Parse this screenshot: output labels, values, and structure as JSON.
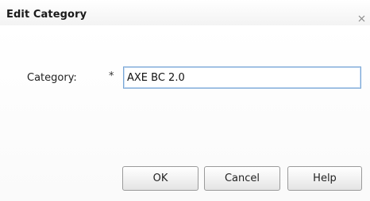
{
  "dialog": {
    "title": "Edit Category"
  },
  "form": {
    "category_label": "Category:",
    "required_marker": "*",
    "category_value": "AXE BC 2.0"
  },
  "buttons": {
    "ok_label": "OK",
    "cancel_label": "Cancel",
    "help_label": "Help"
  },
  "icons": {
    "close": "close-icon"
  }
}
